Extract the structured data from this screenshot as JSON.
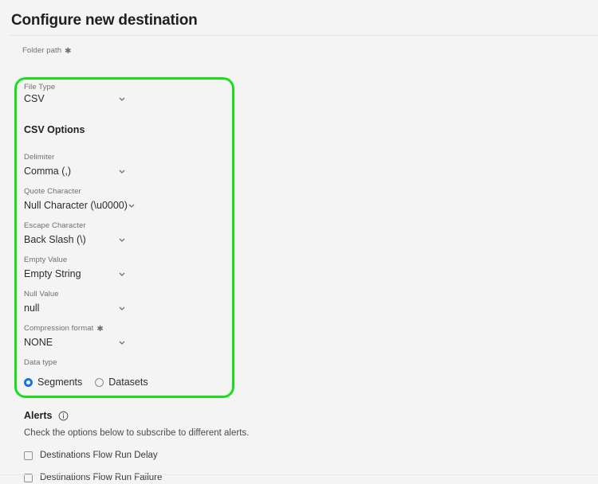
{
  "header": {
    "title": "Configure new destination"
  },
  "folder_path": {
    "label": "Folder path",
    "required_mark": "✱",
    "value": ""
  },
  "file_type": {
    "label": "File Type",
    "value": "CSV",
    "chevron_icon": "chevron-down-icon"
  },
  "csv_options": {
    "section_title": "CSV Options",
    "fields": [
      {
        "label": "Delimiter",
        "value": "Comma (,)",
        "required": false
      },
      {
        "label": "Quote Character",
        "value": "Null Character (\\u0000)",
        "required": false
      },
      {
        "label": "Escape Character",
        "value": "Back Slash (\\)",
        "required": false
      },
      {
        "label": "Empty Value",
        "value": "Empty String",
        "required": false
      },
      {
        "label": "Null Value",
        "value": "null",
        "required": false
      },
      {
        "label": "Compression format",
        "value": "NONE",
        "required": true
      }
    ]
  },
  "data_type": {
    "label": "Data type",
    "options": [
      {
        "label": "Segments",
        "selected": true
      },
      {
        "label": "Datasets",
        "selected": false
      }
    ]
  },
  "alerts": {
    "title": "Alerts",
    "info_icon": "info-circle-icon",
    "description": "Check the options below to subscribe to different alerts.",
    "checkboxes": [
      {
        "label": "Destinations Flow Run Delay",
        "checked": false
      },
      {
        "label": "Destinations Flow Run Failure",
        "checked": false
      }
    ]
  },
  "highlight": {
    "color": "#19e019",
    "target": "csv-options-panel"
  },
  "required_mark": "✱",
  "colors": {
    "background": "#f4f4f4",
    "accent_blue": "#1473e6",
    "highlight_green": "#19e019",
    "text_primary": "#2c2c2c",
    "text_muted": "#6e6e6e"
  }
}
